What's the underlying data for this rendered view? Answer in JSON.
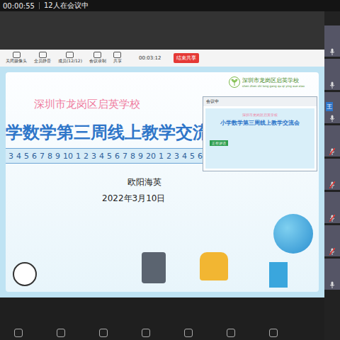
{
  "status": {
    "timer": "00:00:55",
    "participants": "12人在会议中"
  },
  "toolbar": {
    "items": [
      {
        "label": "关闭摄像头"
      },
      {
        "label": "全员静音"
      },
      {
        "label": "成员(12/12)"
      },
      {
        "label": "会议录制"
      },
      {
        "label": "共享"
      }
    ],
    "share_timer": "00:03:12",
    "end_button": "结束共享"
  },
  "slide": {
    "school": "深圳市龙岗区启英学校",
    "logo_text": "深圳市龙岗区启英学校",
    "logo_pinyin": "shen zhen shi long gang qu qi ying xue xiao",
    "title": "学数学第三周线上教学交流会",
    "ruler": [
      "3",
      "4",
      "5",
      "6",
      "7",
      "8",
      "9",
      "10",
      "1",
      "2",
      "3",
      "4",
      "5",
      "6",
      "7",
      "8",
      "9",
      "20",
      "1",
      "2",
      "3",
      "4",
      "5",
      "6"
    ],
    "presenter": "欧阳海英",
    "date": "2022年3月10日"
  },
  "inset": {
    "title": "会议中",
    "slide_title": "小学数学第三周线上教学交流会",
    "school": "深圳市龙岗区启英学校",
    "speaker": "正在讲话"
  },
  "participants": [
    {
      "name": "",
      "muted": false
    },
    {
      "name": "",
      "muted": false
    },
    {
      "name": "王",
      "muted": false
    },
    {
      "name": "",
      "muted": true
    },
    {
      "name": "",
      "muted": true
    },
    {
      "name": "",
      "muted": true
    },
    {
      "name": "",
      "muted": true
    },
    {
      "name": "",
      "muted": false
    }
  ]
}
